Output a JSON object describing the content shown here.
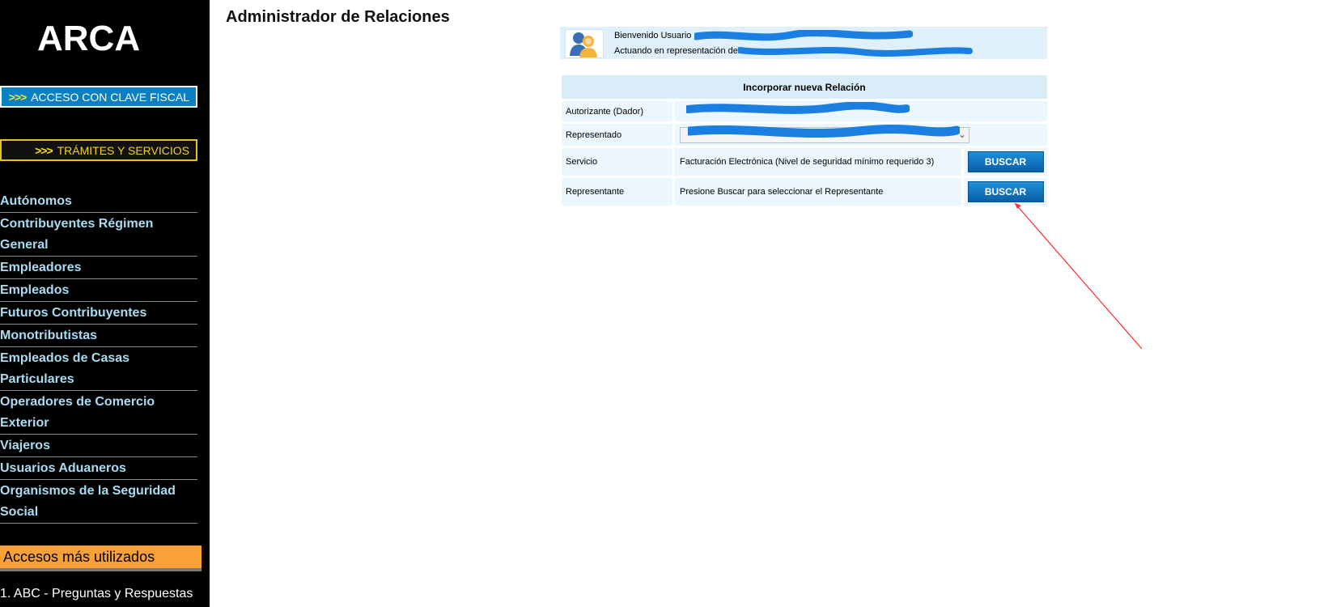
{
  "sidebar": {
    "logo_text": "ARCA",
    "clave_fiscal": {
      "arrows": ">>>",
      "label": "ACCESO CON CLAVE FISCAL"
    },
    "tramites": {
      "arrows": ">>>",
      "label": "TRÁMITES Y SERVICIOS"
    },
    "nav_items": [
      {
        "label": "Autónomos"
      },
      {
        "label": "Contribuyentes Régimen General"
      },
      {
        "label": "Empleadores"
      },
      {
        "label": "Empleados"
      },
      {
        "label": "Futuros Contribuyentes"
      },
      {
        "label": "Monotributistas"
      },
      {
        "label": "Empleados de Casas Particulares"
      },
      {
        "label": "Operadores de Comercio Exterior"
      },
      {
        "label": "Viajeros"
      },
      {
        "label": "Usuarios Aduaneros"
      },
      {
        "label": "Organismos de la Seguridad Social"
      }
    ],
    "accesos_title": "Accesos más utilizados",
    "accesos_first": "1. ABC - Preguntas y Respuestas"
  },
  "main": {
    "title": "Administrador de Relaciones",
    "welcome": {
      "line1_prefix": "Bienvenido Usuario ",
      "line2_prefix": "Actuando en representación de "
    },
    "form": {
      "header": "Incorporar nueva Relación",
      "rows": [
        {
          "label": "Autorizante (Dador)"
        },
        {
          "label": "Representado"
        },
        {
          "label": "Servicio",
          "value": "Facturación Electrónica (Nivel de seguridad mínimo requerido 3)",
          "button": "BUSCAR"
        },
        {
          "label": "Representante",
          "value": "Presione Buscar para seleccionar el Representante",
          "button": "BUSCAR"
        }
      ]
    }
  },
  "colors": {
    "sidebar_bg": "#000000",
    "nav_text": "#a9dcf3",
    "clave_bg": "#0a7fc2",
    "accesos_bg": "#f9a037",
    "panel_bg": "#ebf6fd",
    "header_bg": "#d9edf9",
    "button_bg": "#0a6fbd",
    "redaction": "#1a7fe0",
    "annotation": "#ff2a2a"
  }
}
